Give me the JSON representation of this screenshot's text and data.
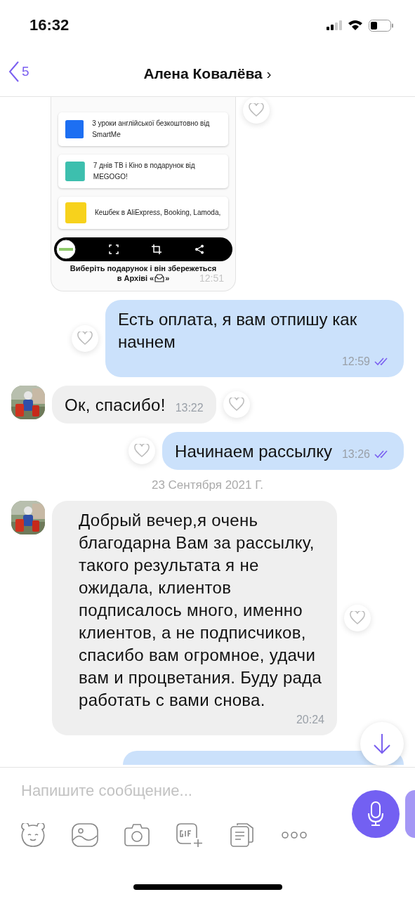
{
  "status_bar": {
    "time": "16:32"
  },
  "nav": {
    "back_count": "5",
    "title": "Алена Ковалёва",
    "chevron": "›"
  },
  "messages": [
    {
      "kind": "screenshot",
      "outgoing": false,
      "offers": [
        {
          "text": "3 уроки англійської безкоштовно від SmartMe",
          "color": "#1d6ff2"
        },
        {
          "text": "7 днів ТВ і Кіно в подарунок від MEGOGO!",
          "color": "#3dbfae"
        },
        {
          "text": "Кешбек в AliExpress, Booking, Lamoda,",
          "color": "#f7d21c"
        }
      ],
      "caption": "Виберіть подарунок і він збережеться",
      "caption_2": "в Архіві «",
      "caption_end": "»",
      "time": "12:51"
    },
    {
      "kind": "text",
      "outgoing": true,
      "text": "Есть оплата, я вам отпишу как начнем",
      "time": "12:59",
      "read": true
    },
    {
      "kind": "text",
      "outgoing": false,
      "text": "Ок, спасибо!",
      "time": "13:22",
      "read": false
    },
    {
      "kind": "text",
      "outgoing": true,
      "text": "Начинаем рассылку",
      "time": "13:26",
      "read": true
    },
    {
      "kind": "date",
      "text": "23 Сентября 2021 Г."
    },
    {
      "kind": "text",
      "outgoing": false,
      "text": "Добрый вечер,я очень благодарна Вам за рассылку, такого результата я не ожидала, клиентов подписалось много, именно клиентов, а не подписчиков, спасибо вам огромное, удачи вам и процветания. Буду рада работать с вами снова.",
      "time": "20:24",
      "read": false
    },
    {
      "kind": "partial",
      "outgoing": true
    }
  ],
  "composer": {
    "placeholder": "Напишите сообщение..."
  }
}
